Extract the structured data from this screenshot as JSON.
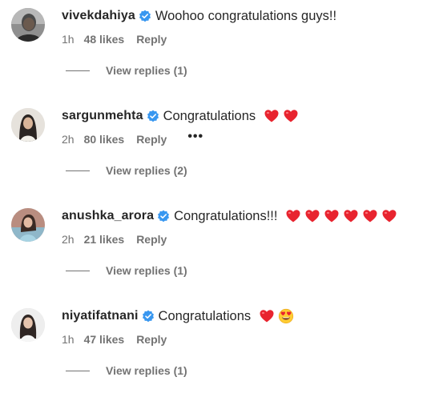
{
  "comments": [
    {
      "username": "vivekdahiya",
      "text": "Woohoo congratulations guys!!",
      "emojis": [],
      "time": "1h",
      "likes": "48 likes",
      "reply_label": "Reply",
      "more": "",
      "view_replies": "View replies (1)"
    },
    {
      "username": "sargunmehta",
      "text": "Congratulations",
      "emojis": [
        "red-heart",
        "red-heart"
      ],
      "time": "2h",
      "likes": "80 likes",
      "reply_label": "Reply",
      "more": "•••",
      "view_replies": "View replies (2)"
    },
    {
      "username": "anushka_arora",
      "text": "Congratulations!!!",
      "emojis": [
        "red-heart",
        "red-heart",
        "red-heart",
        "red-heart",
        "red-heart",
        "red-heart"
      ],
      "time": "2h",
      "likes": "21 likes",
      "reply_label": "Reply",
      "more": "",
      "view_replies": "View replies (1)"
    },
    {
      "username": "niyatifatnani",
      "text": "Congratulations",
      "emojis": [
        "red-heart",
        "heart-eyes-face"
      ],
      "time": "1h",
      "likes": "47 likes",
      "reply_label": "Reply",
      "more": "",
      "view_replies": "View replies (1)"
    }
  ],
  "colors": {
    "verified_badge": "#3897f0",
    "heart": "#e8242f",
    "text_primary": "#262626",
    "text_secondary": "#737373"
  }
}
